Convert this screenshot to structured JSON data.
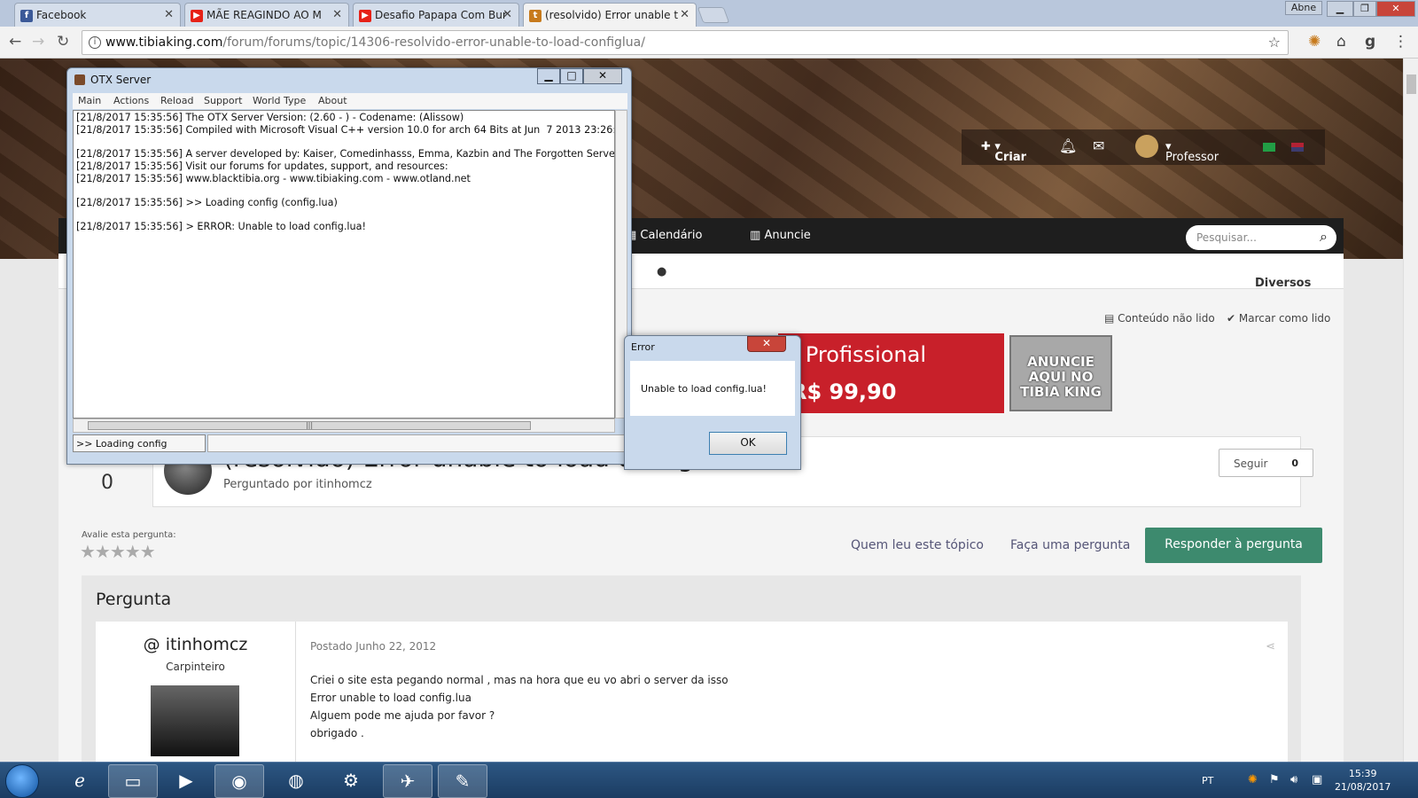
{
  "browser": {
    "tabs": [
      {
        "label": "Facebook",
        "icon": "facebook-icon",
        "color": "#3b5998"
      },
      {
        "label": "MÃE REAGINDO AO M",
        "icon": "youtube-icon",
        "color": "#e62117"
      },
      {
        "label": "Desafio Papapa Com Bur",
        "icon": "youtube-icon",
        "color": "#e62117"
      },
      {
        "label": "(resolvido) Error unable t",
        "icon": "tibiaking-icon",
        "color": "#c77a1c"
      }
    ],
    "user": "Abne",
    "url_host": "www.tibiaking.com",
    "url_path": "/forum/forums/topic/14306-resolvido-error-unable-to-load-configlua/"
  },
  "site": {
    "userbar": {
      "criar": "Criar",
      "user": "Professor"
    },
    "nav": {
      "calendario": "Calendário",
      "anuncie": "Anuncie"
    },
    "search_placeholder": "Pesquisar...",
    "subnav": "Diversos",
    "unread": "Conteúdo não lido",
    "mark_read": "Marcar como lido",
    "ad_line1": "S Profissional",
    "ad_line2": "R$ 99,90",
    "ad2_text": "ANUNCIE AQUI NO TIBIA KING",
    "votes": "0",
    "title": "(resolvido) Error unable to load config.lua",
    "asked_by": "Perguntado por itinhomcz",
    "follow_label": "Seguir",
    "follow_count": "0",
    "rate_label": "Avalie esta pergunta:",
    "stars": "★★★★★",
    "link_who_read": "Quem leu este tópico",
    "link_ask": "Faça uma pergunta",
    "reply_button": "Responder à pergunta",
    "section_title": "Pergunta",
    "author_name": "@ itinhomcz",
    "author_rank": "Carpinteiro",
    "post_date": "Postado Junho 22, 2012",
    "post_lines": [
      "Criei o site esta pegando normal , mas na hora que eu vo abri o server da isso",
      "Error unable to load config.lua",
      "Alguem pode me ajuda por favor ?",
      "obrigado ."
    ]
  },
  "otx": {
    "title": "OTX Server",
    "menu": [
      "Main",
      "Actions",
      "Reload",
      "Support",
      "World Type",
      "About"
    ],
    "console": [
      "[21/8/2017 15:35:56] The OTX Server Version: (2.60 - ) - Codename: (Alissow)",
      "[21/8/2017 15:35:56] Compiled with Microsoft Visual C++ version 10.0 for arch 64 Bits at Jun  7 2013 23:26:",
      "",
      "[21/8/2017 15:35:56] A server developed by: Kaiser, Comedinhasss, Emma, Kazbin and The Forgotten Server",
      "[21/8/2017 15:35:56] Visit our forums for updates, support, and resources:",
      "[21/8/2017 15:35:56] www.blacktibia.org - www.tibiaking.com - www.otland.net",
      "",
      "[21/8/2017 15:35:56] >> Loading config (config.lua)",
      "",
      "[21/8/2017 15:35:56] > ERROR: Unable to load config.lua!"
    ],
    "status": ">> Loading config"
  },
  "error_dialog": {
    "title": "Error",
    "message": "Unable to load config.lua!",
    "ok": "OK"
  },
  "taskbar": {
    "lang": "PT",
    "time": "15:39",
    "date": "21/08/2017"
  },
  "colors": {
    "reply_green": "#3d8a6e",
    "ad_red": "#c8202a"
  }
}
